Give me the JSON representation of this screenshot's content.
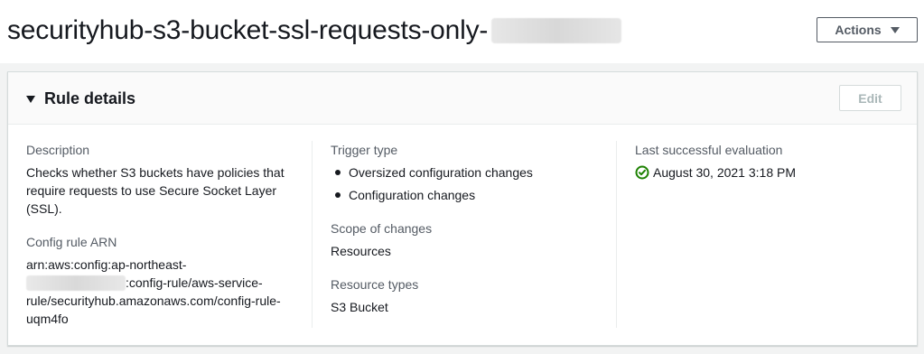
{
  "header": {
    "title": "securityhub-s3-bucket-ssl-requests-only-",
    "actions_label": "Actions",
    "actions_icon": "caret-down-icon"
  },
  "panel": {
    "title": "Rule details",
    "toggle_icon": "caret-down-icon",
    "edit_label": "Edit",
    "columns": {
      "description": {
        "label": "Description",
        "value": "Checks whether S3 buckets have policies that require requests to use Secure Socket Layer (SSL)."
      },
      "config_rule_arn": {
        "label": "Config rule ARN",
        "line1": "arn:aws:config:ap-northeast-",
        "line2_suffix": ":config-rule/aws-service-",
        "line3": "rule/securityhub.amazonaws.com/config-rule-",
        "line4": "uqm4fo"
      },
      "trigger_type": {
        "label": "Trigger type",
        "items": [
          "Oversized configuration changes",
          "Configuration changes"
        ]
      },
      "scope_of_changes": {
        "label": "Scope of changes",
        "value": "Resources"
      },
      "resource_types": {
        "label": "Resource types",
        "value": "S3 Bucket"
      },
      "last_evaluation": {
        "label": "Last successful evaluation",
        "value": "August 30, 2021 3:18 PM",
        "status_icon": "success-check-circle-icon",
        "status_color": "#1d8102"
      }
    }
  },
  "colors": {
    "text": "#16191f",
    "label": "#545b64",
    "border": "#d5dbdb",
    "background": "#f2f3f3",
    "disabled": "#aab7b8"
  }
}
